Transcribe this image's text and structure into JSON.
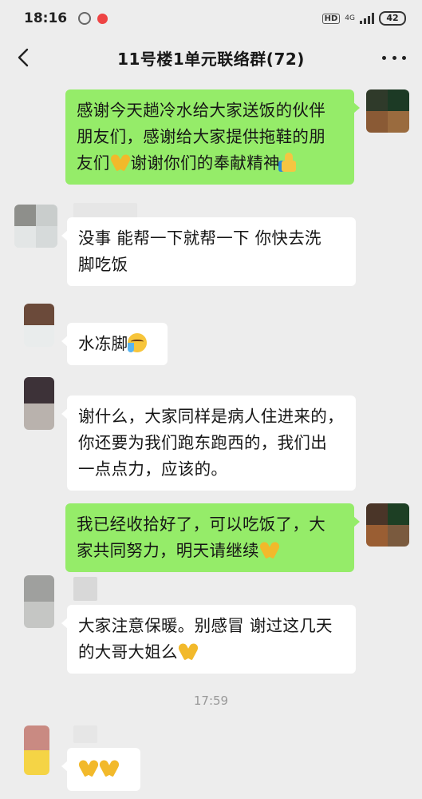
{
  "status_bar": {
    "time": "18:16",
    "hd": "HD",
    "network": "4G",
    "battery": "42"
  },
  "header": {
    "title": "11号楼1单元联络群(72)"
  },
  "messages": [
    {
      "side": "out",
      "lines": [
        "感谢今天趟冷水给大家送饭的伙伴",
        "朋友们，感谢给大家提供拖鞋的朋",
        "友们"
      ],
      "mid": "谢谢你们的奉献精神"
    },
    {
      "side": "in",
      "lines": [
        "没事 能帮一下就帮一下 你快去洗",
        "脚吃饭"
      ]
    },
    {
      "side": "in",
      "text": "水冻脚"
    },
    {
      "side": "in",
      "lines": [
        "谢什么，大家同样是病人住进来的，",
        "你还要为我们跑东跑西的，我们出",
        "一点点力，应该的。"
      ]
    },
    {
      "side": "out",
      "lines": [
        "我已经收拾好了，可以吃饭了，大",
        "家共同努力，明天请继续"
      ]
    },
    {
      "side": "in",
      "lines": [
        "大家注意保暖。别感冒 谢过这几天",
        "的大哥大姐么"
      ]
    }
  ],
  "timestamp": "17:59",
  "colors": {
    "background": "#ededed",
    "outgoing_bubble": "#95ec69",
    "incoming_bubble": "#ffffff"
  },
  "icons": {
    "back": "chevron-left-icon",
    "more": "more-dots-icon",
    "pray": "praying-hands-emoji",
    "thumb": "thumbs-up-emoji",
    "cry": "crying-laughing-emoji"
  }
}
